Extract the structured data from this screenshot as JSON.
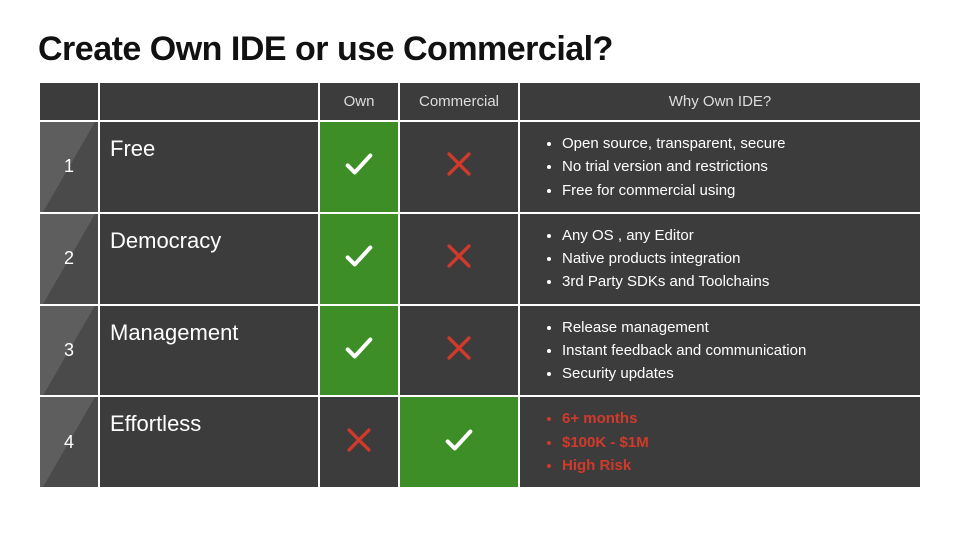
{
  "title": "Create Own IDE or use Commercial?",
  "headers": {
    "own": "Own",
    "commercial": "Commercial",
    "why": "Why Own IDE?"
  },
  "rows": [
    {
      "num": "1",
      "label": "Free",
      "own": true,
      "commercial": false,
      "red": false,
      "why": [
        "Open source, transparent, secure",
        "No trial version and restrictions",
        "Free for commercial using"
      ]
    },
    {
      "num": "2",
      "label": "Democracy",
      "own": true,
      "commercial": false,
      "red": false,
      "why": [
        "Any OS , any Editor",
        "Native products integration",
        "3rd Party SDKs and Toolchains"
      ]
    },
    {
      "num": "3",
      "label": "Management",
      "own": true,
      "commercial": false,
      "red": false,
      "why": [
        "Release management",
        "Instant feedback and communication",
        "Security updates"
      ]
    },
    {
      "num": "4",
      "label": "Effortless",
      "own": false,
      "commercial": true,
      "red": true,
      "why": [
        "6+ months",
        "$100K - $1M",
        "High Risk"
      ]
    }
  ]
}
